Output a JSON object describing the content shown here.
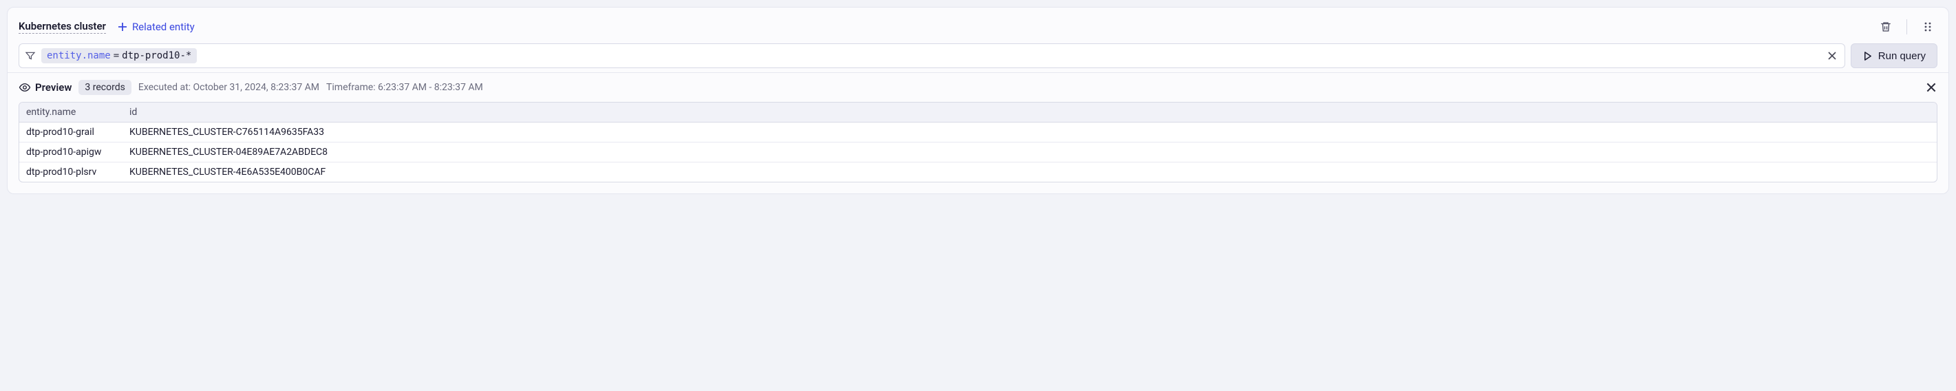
{
  "header": {
    "title": "Kubernetes cluster",
    "related_entity_label": "Related entity"
  },
  "query": {
    "property": "entity.name",
    "operator": "=",
    "value": "dtp-prod10-*",
    "run_label": "Run query"
  },
  "preview": {
    "label": "Preview",
    "records_badge": "3 records",
    "executed_at": "Executed at: October 31, 2024, 8:23:37 AM",
    "timeframe": "Timeframe: 6:23:37 AM - 8:23:37 AM"
  },
  "table": {
    "columns": {
      "name": "entity.name",
      "id": "id"
    },
    "rows": [
      {
        "name": "dtp-prod10-grail",
        "id": "KUBERNETES_CLUSTER-C765114A9635FA33"
      },
      {
        "name": "dtp-prod10-apigw",
        "id": "KUBERNETES_CLUSTER-04E89AE7A2ABDEC8"
      },
      {
        "name": "dtp-prod10-plsrv",
        "id": "KUBERNETES_CLUSTER-4E6A535E400B0CAF"
      }
    ]
  }
}
